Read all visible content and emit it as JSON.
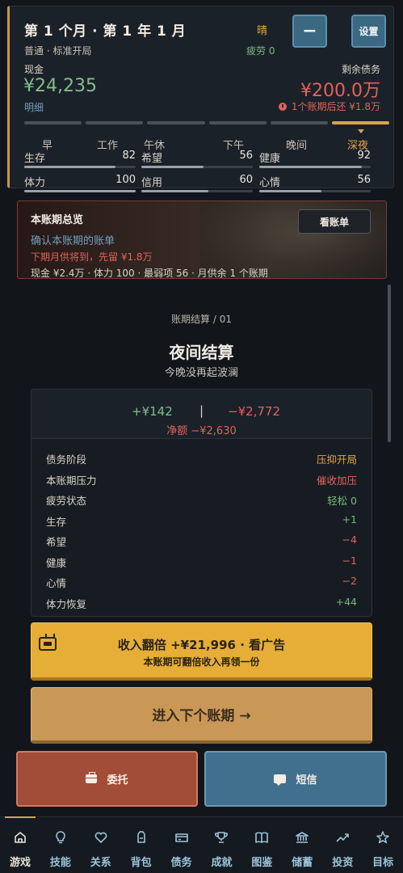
{
  "status": {
    "month_title": "第 1 个月 · 第 1 年 1 月",
    "weather": "晴",
    "fatigue": "疲劳 0",
    "minus_label": "−",
    "settings_label": "设置",
    "mode": "普通 · 标准开局",
    "cash_label": "现金",
    "cash_value": "¥24,235",
    "detail_link": "明细",
    "debt_label": "剩余债务",
    "debt_value": "¥200.0万",
    "due_text": "1个账期后还 ¥1.8万",
    "periods": [
      "早",
      "工作",
      "午休",
      "下午",
      "晚间",
      "深夜"
    ],
    "active_period_index": 5,
    "stats": [
      {
        "name": "生存",
        "value": "82",
        "level": 0.82
      },
      {
        "name": "希望",
        "value": "56",
        "level": 0.56
      },
      {
        "name": "健康",
        "value": "92",
        "level": 0.92
      },
      {
        "name": "体力",
        "value": "100",
        "level": 1.0
      },
      {
        "name": "信用",
        "value": "60",
        "level": 0.6
      },
      {
        "name": "心情",
        "value": "56",
        "level": 0.56
      }
    ]
  },
  "overview": {
    "title": "本账期总览",
    "link": "确认本账期的账单",
    "warning": "下期月供将到，先留 ¥1.8万",
    "summary": "现金 ¥2.4万 · 体力 100 · 最弱项 56 · 月供余 1 个账期",
    "button": "看账单"
  },
  "settlement": {
    "crumb": "账期结算 / 01",
    "title": "夜间结算",
    "subtitle": "今晚没再起波澜",
    "income": "+¥142",
    "separator": "|",
    "expense": "−¥2,772",
    "net": "净额 −¥2,630",
    "rows": [
      {
        "label": "债务阶段",
        "value": "压抑开局",
        "tone": "orange"
      },
      {
        "label": "本账期压力",
        "value": "催收加压",
        "tone": "red"
      },
      {
        "label": "疲劳状态",
        "value": "轻松 0",
        "tone": "green"
      },
      {
        "label": "生存",
        "value": "+1",
        "tone": "green"
      },
      {
        "label": "希望",
        "value": "−4",
        "tone": "red"
      },
      {
        "label": "健康",
        "value": "−1",
        "tone": "red"
      },
      {
        "label": "心情",
        "value": "−2",
        "tone": "red"
      },
      {
        "label": "体力恢复",
        "value": "+44",
        "tone": "green"
      }
    ]
  },
  "actions": {
    "ad_main": "收入翻倍 +¥21,996 · 看广告",
    "ad_sub": "本账期可翻倍收入再领一份",
    "next": "进入下个账期 →",
    "entrust": "委托",
    "sms": "短信"
  },
  "nav": [
    {
      "label": "游戏",
      "icon": "home-icon"
    },
    {
      "label": "技能",
      "icon": "lightbulb-icon"
    },
    {
      "label": "关系",
      "icon": "heart-icon"
    },
    {
      "label": "背包",
      "icon": "backpack-icon"
    },
    {
      "label": "债务",
      "icon": "card-icon"
    },
    {
      "label": "成就",
      "icon": "trophy-icon"
    },
    {
      "label": "图鉴",
      "icon": "book-icon"
    },
    {
      "label": "储蓄",
      "icon": "bank-icon"
    },
    {
      "label": "投资",
      "icon": "trend-icon"
    },
    {
      "label": "目标",
      "icon": "star-icon"
    }
  ],
  "active_nav_index": 0
}
